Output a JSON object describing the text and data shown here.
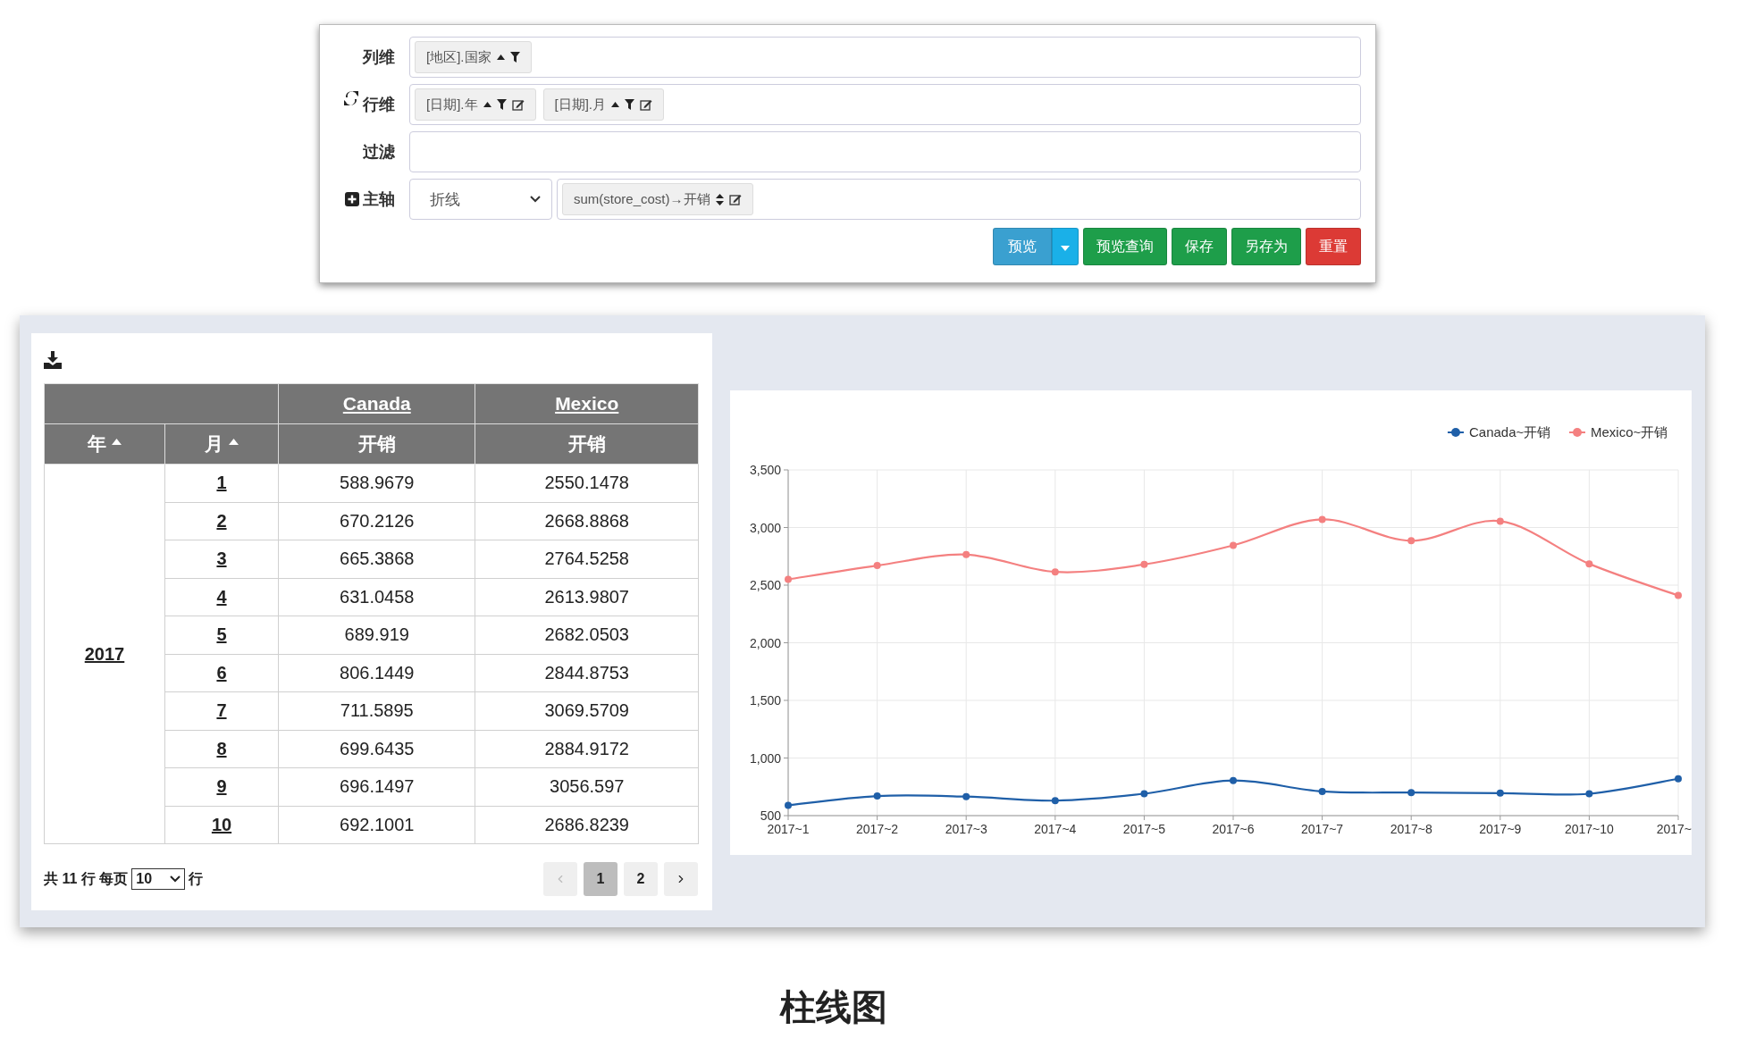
{
  "config": {
    "rows": [
      {
        "label": "列维",
        "chips": [
          {
            "text": "[地区].国家",
            "kind": "dimension",
            "editable": false
          }
        ]
      },
      {
        "label": "行维",
        "chips": [
          {
            "text": "[日期].年",
            "kind": "dimension",
            "editable": true
          },
          {
            "text": "[日期].月",
            "kind": "dimension",
            "editable": true
          }
        ]
      },
      {
        "label": "过滤",
        "chips": []
      },
      {
        "label": "主轴",
        "addable": true,
        "select": "折线",
        "chips": [
          {
            "text": "sum(store_cost)→开销",
            "kind": "measure",
            "editable": true
          }
        ]
      }
    ],
    "buttons": [
      {
        "label": "预览",
        "kind": "split"
      },
      {
        "label": "预览查询",
        "kind": "success"
      },
      {
        "label": "保存",
        "kind": "success"
      },
      {
        "label": "另存为",
        "kind": "success"
      },
      {
        "label": "重置",
        "kind": "danger"
      }
    ]
  },
  "table": {
    "countries": [
      "Canada",
      "Mexico"
    ],
    "row_headers": [
      "年",
      "月"
    ],
    "measures": [
      "开销",
      "开销"
    ],
    "year": "2017",
    "rows": [
      {
        "month": "1",
        "values": [
          "588.9679",
          "2550.1478"
        ]
      },
      {
        "month": "2",
        "values": [
          "670.2126",
          "2668.8868"
        ]
      },
      {
        "month": "3",
        "values": [
          "665.3868",
          "2764.5258"
        ]
      },
      {
        "month": "4",
        "values": [
          "631.0458",
          "2613.9807"
        ]
      },
      {
        "month": "5",
        "values": [
          "689.919",
          "2682.0503"
        ]
      },
      {
        "month": "6",
        "values": [
          "806.1449",
          "2844.8753"
        ]
      },
      {
        "month": "7",
        "values": [
          "711.5895",
          "3069.5709"
        ]
      },
      {
        "month": "8",
        "values": [
          "699.6435",
          "2884.9172"
        ]
      },
      {
        "month": "9",
        "values": [
          "696.1497",
          "3056.597"
        ]
      },
      {
        "month": "10",
        "values": [
          "692.1001",
          "2686.8239"
        ]
      }
    ],
    "pagination": {
      "total": "共 11 行 每页",
      "page_size": "10",
      "suffix": "行",
      "prev_disabled": true,
      "next_disabled": false,
      "pages": [
        {
          "label": "1",
          "selected": true
        },
        {
          "label": "2",
          "selected": false
        }
      ]
    }
  },
  "chart": {
    "chart_data": {
      "type": "line",
      "categories": [
        "2017~1",
        "2017~2",
        "2017~3",
        "2017~4",
        "2017~5",
        "2017~6",
        "2017~7",
        "2017~8",
        "2017~9",
        "2017~10",
        "2017~"
      ],
      "series": [
        {
          "name": "Canada~开销",
          "color": "#1f5fa8",
          "marker": "circle",
          "values": [
            590,
            670,
            665,
            630,
            690,
            805,
            710,
            700,
            695,
            690,
            820
          ]
        },
        {
          "name": "Mexico~开销",
          "color": "#f48080",
          "marker": "circle",
          "values": [
            2550,
            2670,
            2765,
            2615,
            2680,
            2845,
            3070,
            2885,
            3055,
            2685,
            2410
          ]
        }
      ],
      "grid": true,
      "legend": true,
      "ylim": [
        500,
        3500
      ],
      "yticks": [
        {
          "value": 500,
          "label": "500"
        },
        {
          "value": 1000,
          "label": "1,000"
        },
        {
          "value": 1500,
          "label": "1,500"
        },
        {
          "value": 2000,
          "label": "2,000"
        },
        {
          "value": 2500,
          "label": "2,500"
        },
        {
          "value": 3000,
          "label": "3,000"
        },
        {
          "value": 3500,
          "label": "3,500"
        }
      ]
    }
  },
  "caption": "柱线图"
}
